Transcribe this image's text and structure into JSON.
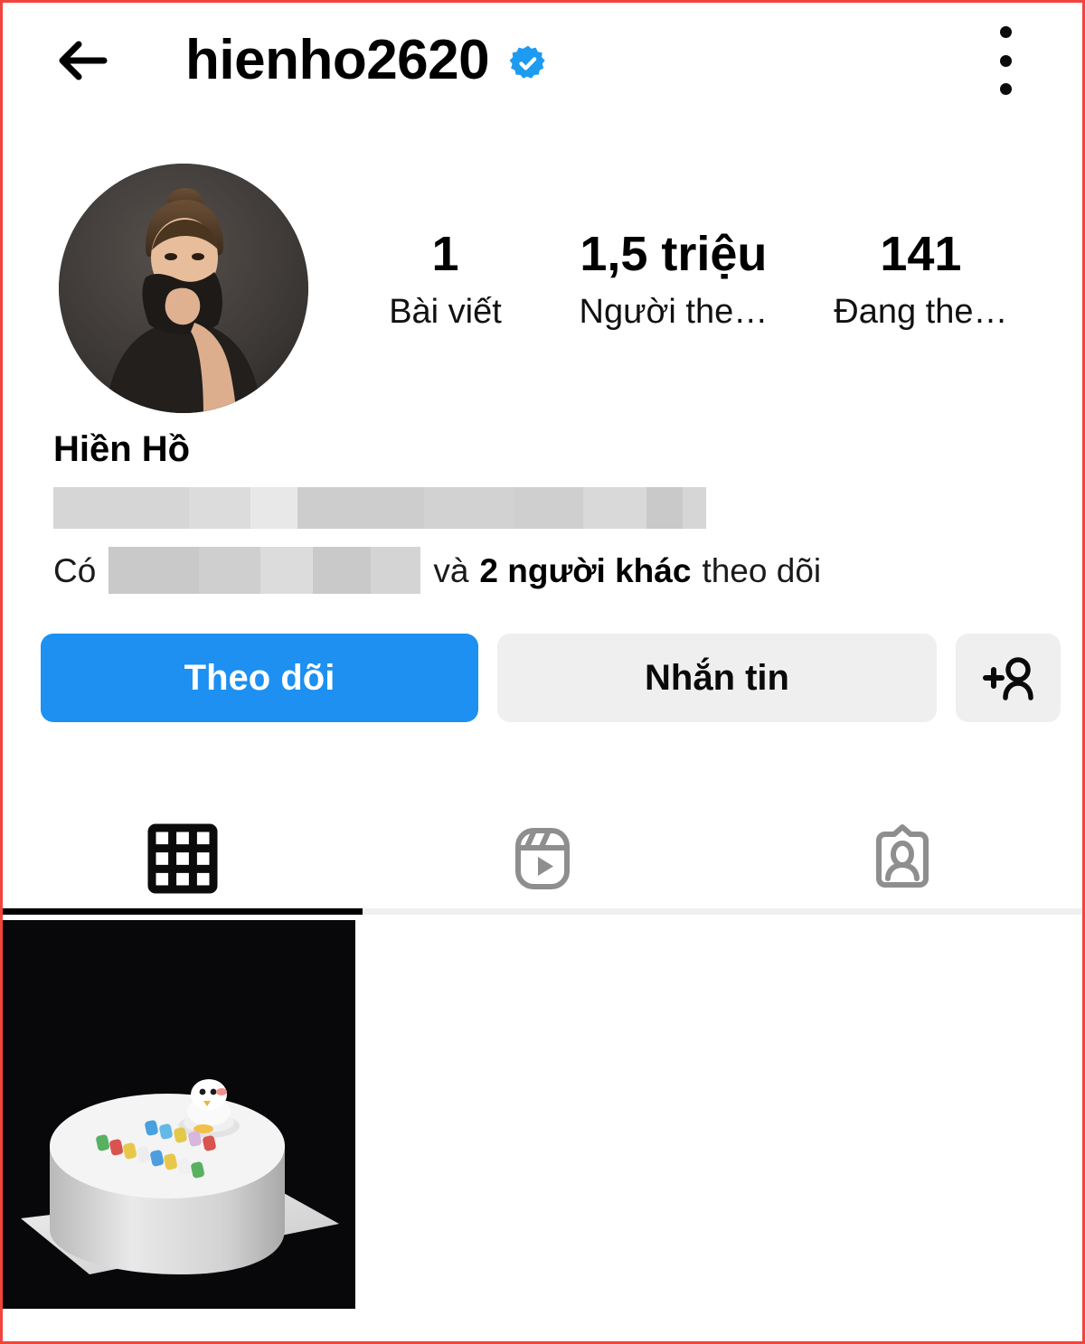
{
  "theme": {
    "accent_blue": "#1d90f1",
    "verified_blue": "#1d9bf0",
    "button_gray": "#efefef",
    "frame_red": "#f2443c"
  },
  "header": {
    "back_icon": "back-arrow-icon",
    "username": "hienho2620",
    "verified_icon": "verified-badge-icon",
    "menu_icon": "overflow-menu-icon"
  },
  "profile": {
    "avatar_alt": "profile-photo",
    "full_name": "Hiền Hồ",
    "bio_redacted": true,
    "stats": [
      {
        "value": "1",
        "label": "Bài viết",
        "name": "posts"
      },
      {
        "value": "1,5 triệu",
        "label": "Người the…",
        "name": "followers"
      },
      {
        "value": "141",
        "label": "Đang the…",
        "name": "following"
      }
    ],
    "followed_by": {
      "prefix": "Có",
      "redacted": true,
      "middle": "và",
      "strong": "2 người khác",
      "suffix": "theo dõi"
    }
  },
  "actions": {
    "follow_label": "Theo dõi",
    "message_label": "Nhắn tin",
    "add_person_icon": "add-person-icon"
  },
  "tabs": [
    {
      "name": "grid",
      "icon": "grid-icon",
      "active": true
    },
    {
      "name": "reels",
      "icon": "reels-icon",
      "active": false
    },
    {
      "name": "tagged",
      "icon": "tagged-icon",
      "active": false
    }
  ],
  "posts": [
    {
      "name": "post-birthday-cake",
      "alt": "white birthday cake with happy birthday letters"
    }
  ]
}
